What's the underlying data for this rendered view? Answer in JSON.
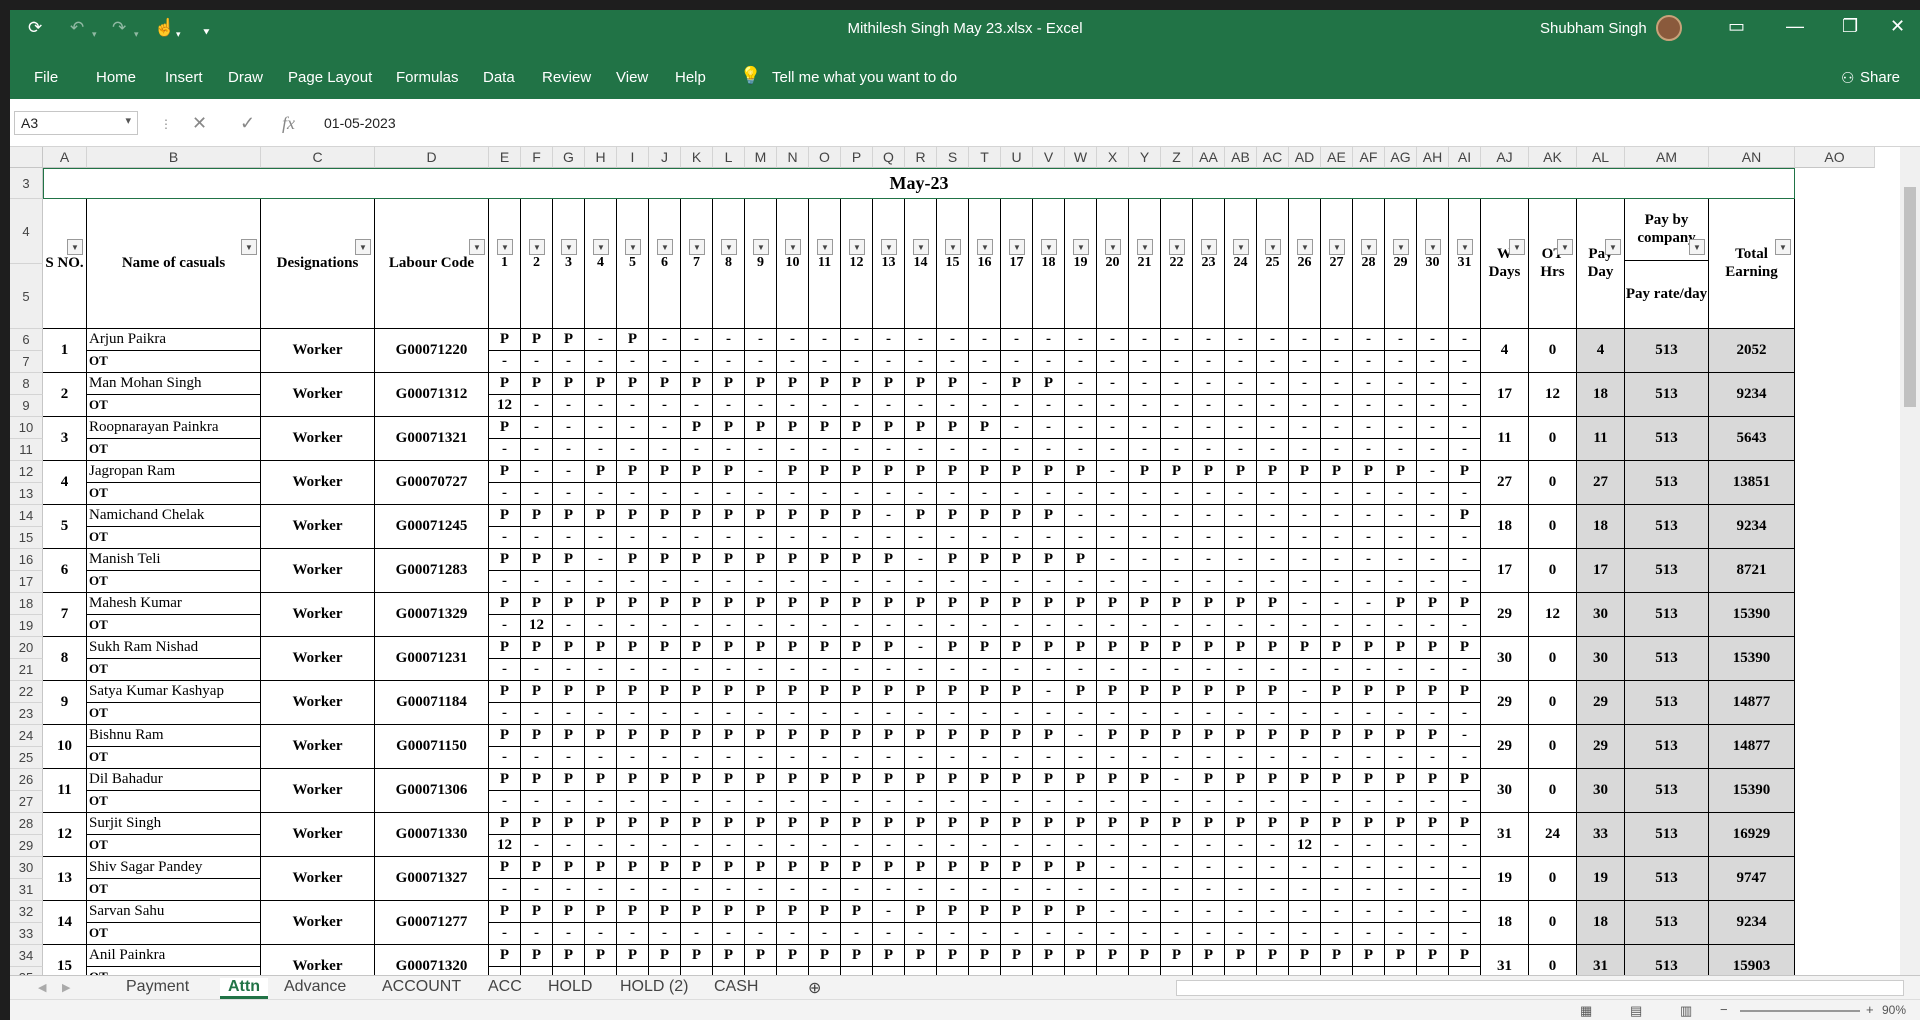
{
  "window": {
    "title": "Mithilesh Singh May 23.xlsx  -  Excel",
    "user": "Shubham Singh"
  },
  "ribbon": {
    "tabs": [
      "File",
      "Home",
      "Insert",
      "Draw",
      "Page Layout",
      "Formulas",
      "Data",
      "Review",
      "View",
      "Help"
    ],
    "tell": "Tell me what you want to do",
    "share": "Share"
  },
  "formula": {
    "cell": "A3",
    "value": "01-05-2023"
  },
  "columns": [
    "A",
    "B",
    "C",
    "D",
    "E",
    "F",
    "G",
    "H",
    "I",
    "J",
    "K",
    "L",
    "M",
    "N",
    "O",
    "P",
    "Q",
    "R",
    "S",
    "T",
    "U",
    "V",
    "W",
    "X",
    "Y",
    "Z",
    "AA",
    "AB",
    "AC",
    "AD",
    "AE",
    "AF",
    "AG",
    "AH",
    "AI",
    "AJ",
    "AK",
    "AL",
    "AM",
    "AN",
    "AO"
  ],
  "sheet": {
    "title": "May-23",
    "headers": {
      "sno": "S NO.",
      "name": "Name of casuals",
      "designation": "Designations",
      "code": "Labour Code",
      "days": [
        "1",
        "2",
        "3",
        "4",
        "5",
        "6",
        "7",
        "8",
        "9",
        "10",
        "11",
        "12",
        "13",
        "14",
        "15",
        "16",
        "17",
        "18",
        "19",
        "20",
        "21",
        "22",
        "23",
        "24",
        "25",
        "26",
        "27",
        "28",
        "29",
        "30",
        "31"
      ],
      "wdays": "W Days",
      "ot": "OT Hrs",
      "payday": "Pay Day",
      "paycompany": "Pay by company",
      "payrate": "Pay rate/day",
      "total": "Total Earning"
    },
    "ot_label": "OT",
    "rows": [
      {
        "sno": "1",
        "name": "Arjun Paikra",
        "designation": "Worker",
        "code": "G00071220",
        "att": "PPP-P--------------------------",
        "ot": "-------------------------------",
        "wdays": "4",
        "ot_hrs": "0",
        "payday": "4",
        "rate": "513",
        "total": "2052"
      },
      {
        "sno": "2",
        "name": "Man Mohan Singh",
        "designation": "Worker",
        "code": "G00071312",
        "att": "PPPPPPPPPPPPPPP-PP-------------",
        "ot": "X------------------------------",
        "wdays": "17",
        "ot_hrs": "12",
        "payday": "18",
        "rate": "513",
        "total": "9234"
      },
      {
        "sno": "3",
        "name": "Roopnarayan Painkra",
        "designation": "Worker",
        "code": "G00071321",
        "att": "P-----PPPPPPPPPP---------------",
        "ot": "-------------------------------",
        "wdays": "11",
        "ot_hrs": "0",
        "payday": "11",
        "rate": "513",
        "total": "5643"
      },
      {
        "sno": "4",
        "name": "Jagropan Ram",
        "designation": "Worker",
        "code": "G00070727",
        "att": "P--PPPPP-PPPPPPPPPP-PPPPPPPPP-P",
        "ot": "-------------------------------",
        "wdays": "27",
        "ot_hrs": "0",
        "payday": "27",
        "rate": "513",
        "total": "13851"
      },
      {
        "sno": "5",
        "name": "Namichand Chelak",
        "designation": "Worker",
        "code": "G00071245",
        "att": "PPPPPPPPPPPP-PPPPP------------P",
        "ot": "-------------------------------",
        "wdays": "18",
        "ot_hrs": "0",
        "payday": "18",
        "rate": "513",
        "total": "9234"
      },
      {
        "sno": "6",
        "name": "Manish Teli",
        "designation": "Worker",
        "code": "G00071283",
        "att": "PPP-PPPPPPPPP-PPPPP------------",
        "ot": "-------------------------------",
        "wdays": "17",
        "ot_hrs": "0",
        "payday": "17",
        "rate": "513",
        "total": "8721"
      },
      {
        "sno": "7",
        "name": "Mahesh Kumar",
        "designation": "Worker",
        "code": "G00071329",
        "att": "PPPPPPPPPPPPPPPPPPPPPPPPP---PPPP",
        "ot": "-X-----------------------------",
        "wdays": "29",
        "ot_hrs": "12",
        "payday": "30",
        "rate": "513",
        "total": "15390"
      },
      {
        "sno": "8",
        "name": "Sukh Ram Nishad",
        "designation": "Worker",
        "code": "G00071231",
        "att": "PPPPPPPPPPPPP-PPPPPPPPPPPPPPPPP",
        "ot": "-------------------------------",
        "wdays": "30",
        "ot_hrs": "0",
        "payday": "30",
        "rate": "513",
        "total": "15390"
      },
      {
        "sno": "9",
        "name": "Satya Kumar Kashyap",
        "designation": "Worker",
        "code": "G00071184",
        "att": "PPPPPPPPPPPPPPPPP-PPPPPPP-PPPPP",
        "ot": "-------------------------------",
        "wdays": "29",
        "ot_hrs": "0",
        "payday": "29",
        "rate": "513",
        "total": "14877"
      },
      {
        "sno": "10",
        "name": "Bishnu Ram",
        "designation": "Worker",
        "code": "G00071150",
        "att": "PPPPPPPPPPPPPPPPPP-PPPPPPPPPPP-",
        "ot": "-------------------------------",
        "wdays": "29",
        "ot_hrs": "0",
        "payday": "29",
        "rate": "513",
        "total": "14877"
      },
      {
        "sno": "11",
        "name": "Dil Bahadur",
        "designation": "Worker",
        "code": "G00071306",
        "att": "PPPPPPPPPPPPPPPPPPPPP-PPPPPPPPP",
        "ot": "-------------------------------",
        "wdays": "30",
        "ot_hrs": "0",
        "payday": "30",
        "rate": "513",
        "total": "15390"
      },
      {
        "sno": "12",
        "name": "Surjit Singh",
        "designation": "Worker",
        "code": "G00071330",
        "att": "PPPPPPPPPPPPPPPPPPPPPPPPPPPPPPP",
        "ot": "X------------------------X-----",
        "wdays": "31",
        "ot_hrs": "24",
        "payday": "33",
        "rate": "513",
        "total": "16929"
      },
      {
        "sno": "13",
        "name": "Shiv Sagar Pandey",
        "designation": "Worker",
        "code": "G00071327",
        "att": "PPPPPPPPPPPPPPPPPPP------------",
        "ot": "-------------------------------",
        "wdays": "19",
        "ot_hrs": "0",
        "payday": "19",
        "rate": "513",
        "total": "9747"
      },
      {
        "sno": "14",
        "name": "Sarvan Sahu",
        "designation": "Worker",
        "code": "G00071277",
        "att": "PPPPPPPPPPPP-PPPPPP------------",
        "ot": "-------------------------------",
        "wdays": "18",
        "ot_hrs": "0",
        "payday": "18",
        "rate": "513",
        "total": "9234"
      },
      {
        "sno": "15",
        "name": "Anil Painkra",
        "designation": "Worker",
        "code": "G00071320",
        "att": "PPPPPPPPPPPPPPPPPPPPPPPPPPPPPPP",
        "ot": "-------------------------------",
        "wdays": "31",
        "ot_hrs": "0",
        "payday": "31",
        "rate": "513",
        "total": "15903"
      }
    ]
  },
  "ot_value": "12",
  "sheets": [
    "Payment",
    "Attn",
    "Advance",
    "ACCOUNT",
    "ACC",
    "HOLD",
    "HOLD (2)",
    "CASH"
  ],
  "active_sheet": "Attn",
  "zoom": "90%"
}
